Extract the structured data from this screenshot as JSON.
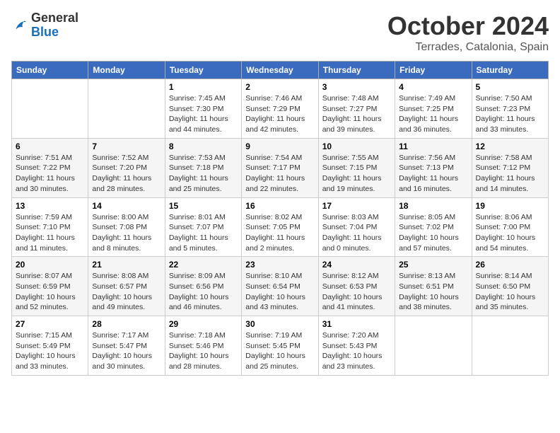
{
  "header": {
    "logo_general": "General",
    "logo_blue": "Blue",
    "month_title": "October 2024",
    "location": "Terrades, Catalonia, Spain"
  },
  "days_of_week": [
    "Sunday",
    "Monday",
    "Tuesday",
    "Wednesday",
    "Thursday",
    "Friday",
    "Saturday"
  ],
  "weeks": [
    [
      {
        "num": "",
        "info": ""
      },
      {
        "num": "",
        "info": ""
      },
      {
        "num": "1",
        "info": "Sunrise: 7:45 AM\nSunset: 7:30 PM\nDaylight: 11 hours and 44 minutes."
      },
      {
        "num": "2",
        "info": "Sunrise: 7:46 AM\nSunset: 7:29 PM\nDaylight: 11 hours and 42 minutes."
      },
      {
        "num": "3",
        "info": "Sunrise: 7:48 AM\nSunset: 7:27 PM\nDaylight: 11 hours and 39 minutes."
      },
      {
        "num": "4",
        "info": "Sunrise: 7:49 AM\nSunset: 7:25 PM\nDaylight: 11 hours and 36 minutes."
      },
      {
        "num": "5",
        "info": "Sunrise: 7:50 AM\nSunset: 7:23 PM\nDaylight: 11 hours and 33 minutes."
      }
    ],
    [
      {
        "num": "6",
        "info": "Sunrise: 7:51 AM\nSunset: 7:22 PM\nDaylight: 11 hours and 30 minutes."
      },
      {
        "num": "7",
        "info": "Sunrise: 7:52 AM\nSunset: 7:20 PM\nDaylight: 11 hours and 28 minutes."
      },
      {
        "num": "8",
        "info": "Sunrise: 7:53 AM\nSunset: 7:18 PM\nDaylight: 11 hours and 25 minutes."
      },
      {
        "num": "9",
        "info": "Sunrise: 7:54 AM\nSunset: 7:17 PM\nDaylight: 11 hours and 22 minutes."
      },
      {
        "num": "10",
        "info": "Sunrise: 7:55 AM\nSunset: 7:15 PM\nDaylight: 11 hours and 19 minutes."
      },
      {
        "num": "11",
        "info": "Sunrise: 7:56 AM\nSunset: 7:13 PM\nDaylight: 11 hours and 16 minutes."
      },
      {
        "num": "12",
        "info": "Sunrise: 7:58 AM\nSunset: 7:12 PM\nDaylight: 11 hours and 14 minutes."
      }
    ],
    [
      {
        "num": "13",
        "info": "Sunrise: 7:59 AM\nSunset: 7:10 PM\nDaylight: 11 hours and 11 minutes."
      },
      {
        "num": "14",
        "info": "Sunrise: 8:00 AM\nSunset: 7:08 PM\nDaylight: 11 hours and 8 minutes."
      },
      {
        "num": "15",
        "info": "Sunrise: 8:01 AM\nSunset: 7:07 PM\nDaylight: 11 hours and 5 minutes."
      },
      {
        "num": "16",
        "info": "Sunrise: 8:02 AM\nSunset: 7:05 PM\nDaylight: 11 hours and 2 minutes."
      },
      {
        "num": "17",
        "info": "Sunrise: 8:03 AM\nSunset: 7:04 PM\nDaylight: 11 hours and 0 minutes."
      },
      {
        "num": "18",
        "info": "Sunrise: 8:05 AM\nSunset: 7:02 PM\nDaylight: 10 hours and 57 minutes."
      },
      {
        "num": "19",
        "info": "Sunrise: 8:06 AM\nSunset: 7:00 PM\nDaylight: 10 hours and 54 minutes."
      }
    ],
    [
      {
        "num": "20",
        "info": "Sunrise: 8:07 AM\nSunset: 6:59 PM\nDaylight: 10 hours and 52 minutes."
      },
      {
        "num": "21",
        "info": "Sunrise: 8:08 AM\nSunset: 6:57 PM\nDaylight: 10 hours and 49 minutes."
      },
      {
        "num": "22",
        "info": "Sunrise: 8:09 AM\nSunset: 6:56 PM\nDaylight: 10 hours and 46 minutes."
      },
      {
        "num": "23",
        "info": "Sunrise: 8:10 AM\nSunset: 6:54 PM\nDaylight: 10 hours and 43 minutes."
      },
      {
        "num": "24",
        "info": "Sunrise: 8:12 AM\nSunset: 6:53 PM\nDaylight: 10 hours and 41 minutes."
      },
      {
        "num": "25",
        "info": "Sunrise: 8:13 AM\nSunset: 6:51 PM\nDaylight: 10 hours and 38 minutes."
      },
      {
        "num": "26",
        "info": "Sunrise: 8:14 AM\nSunset: 6:50 PM\nDaylight: 10 hours and 35 minutes."
      }
    ],
    [
      {
        "num": "27",
        "info": "Sunrise: 7:15 AM\nSunset: 5:49 PM\nDaylight: 10 hours and 33 minutes."
      },
      {
        "num": "28",
        "info": "Sunrise: 7:17 AM\nSunset: 5:47 PM\nDaylight: 10 hours and 30 minutes."
      },
      {
        "num": "29",
        "info": "Sunrise: 7:18 AM\nSunset: 5:46 PM\nDaylight: 10 hours and 28 minutes."
      },
      {
        "num": "30",
        "info": "Sunrise: 7:19 AM\nSunset: 5:45 PM\nDaylight: 10 hours and 25 minutes."
      },
      {
        "num": "31",
        "info": "Sunrise: 7:20 AM\nSunset: 5:43 PM\nDaylight: 10 hours and 23 minutes."
      },
      {
        "num": "",
        "info": ""
      },
      {
        "num": "",
        "info": ""
      }
    ]
  ]
}
